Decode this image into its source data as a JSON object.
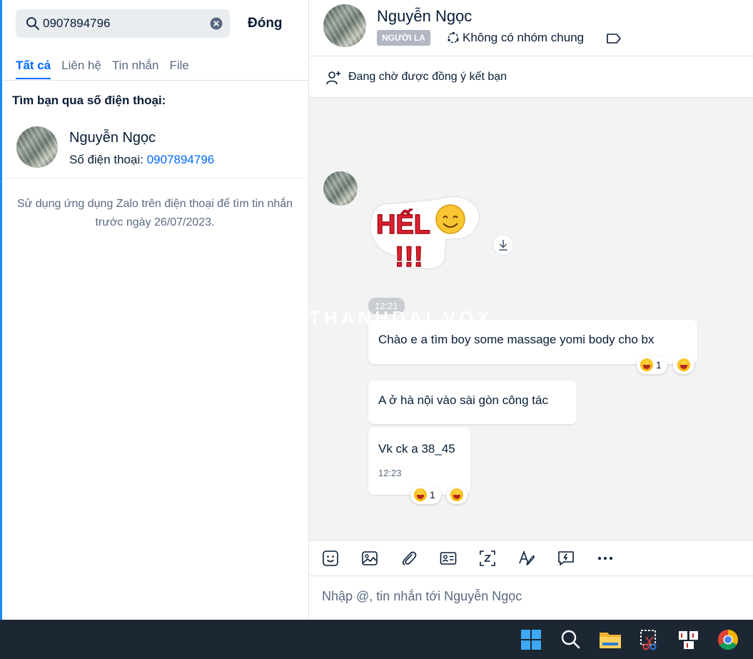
{
  "search": {
    "value": "0907894796",
    "close_label": "Đóng"
  },
  "tabs": [
    {
      "label": "Tất cả",
      "active": true
    },
    {
      "label": "Liên hệ"
    },
    {
      "label": "Tin nhắn"
    },
    {
      "label": "File"
    }
  ],
  "phone_search": {
    "title": "Tìm bạn qua số điện thoại:",
    "result": {
      "name": "Nguyễn Ngọc",
      "phone_label": "Số điện thoại:",
      "phone": "0907894796"
    }
  },
  "hint": "Sử dụng ứng dụng Zalo trên điện thoại để tìm tin nhắn trước ngày 26/07/2023.",
  "chat": {
    "name": "Nguyễn Ngọc",
    "badge": "NGƯỜI LẠ",
    "groups": "Không có nhóm chung",
    "pending": "Đang chờ được đồng ý kết bạn",
    "sticker_text": "HẾL",
    "watermark": "THANHDAI.VOX",
    "time_divider": "12:21",
    "messages": [
      {
        "text": "Chào e a tìm boy some massage yomi body cho bx",
        "reaction_count": "1"
      },
      {
        "text": "A ở hà nội vào sài gòn công tác"
      },
      {
        "text": "Vk ck a 38_45",
        "time": "12:23",
        "reaction_count": "1"
      }
    ],
    "composer_placeholder": "Nhập @, tin nhắn tới Nguyễn Ngọc"
  },
  "toolbar_icons": [
    "sticker-icon",
    "image-icon",
    "attach-icon",
    "contact-card-icon",
    "screenshot-icon",
    "text-format-icon",
    "quick-message-icon",
    "more-icon"
  ],
  "taskbar_icons": [
    "windows-start-icon",
    "search-icon",
    "file-explorer-icon",
    "snipping-tool-icon",
    "unikey-icon",
    "chrome-icon"
  ],
  "colors": {
    "accent": "#0068ff",
    "badge": "#b0b7c0",
    "chat_bg": "#f3f3f3",
    "taskbar": "#1c2733"
  }
}
